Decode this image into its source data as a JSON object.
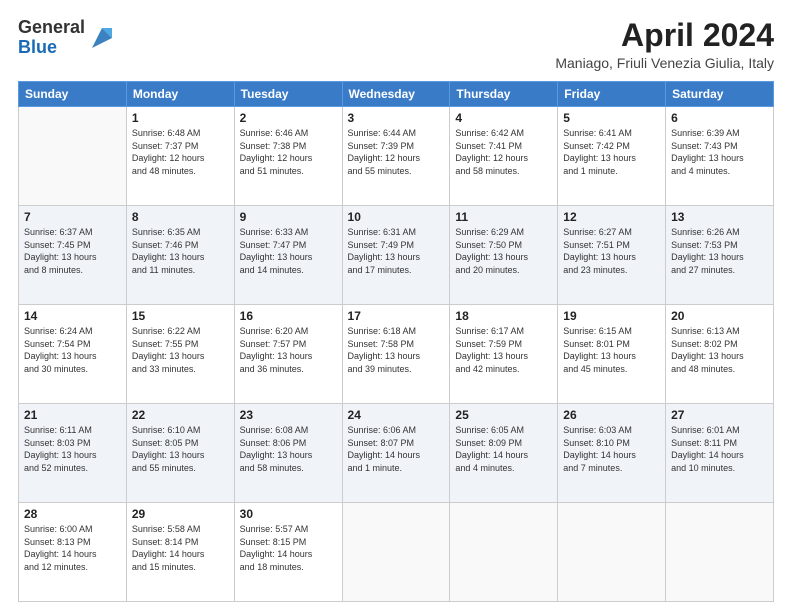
{
  "header": {
    "logo_general": "General",
    "logo_blue": "Blue",
    "month_title": "April 2024",
    "location": "Maniago, Friuli Venezia Giulia, Italy"
  },
  "days_of_week": [
    "Sunday",
    "Monday",
    "Tuesday",
    "Wednesday",
    "Thursday",
    "Friday",
    "Saturday"
  ],
  "weeks": [
    [
      {
        "day": "",
        "info": ""
      },
      {
        "day": "1",
        "info": "Sunrise: 6:48 AM\nSunset: 7:37 PM\nDaylight: 12 hours\nand 48 minutes."
      },
      {
        "day": "2",
        "info": "Sunrise: 6:46 AM\nSunset: 7:38 PM\nDaylight: 12 hours\nand 51 minutes."
      },
      {
        "day": "3",
        "info": "Sunrise: 6:44 AM\nSunset: 7:39 PM\nDaylight: 12 hours\nand 55 minutes."
      },
      {
        "day": "4",
        "info": "Sunrise: 6:42 AM\nSunset: 7:41 PM\nDaylight: 12 hours\nand 58 minutes."
      },
      {
        "day": "5",
        "info": "Sunrise: 6:41 AM\nSunset: 7:42 PM\nDaylight: 13 hours\nand 1 minute."
      },
      {
        "day": "6",
        "info": "Sunrise: 6:39 AM\nSunset: 7:43 PM\nDaylight: 13 hours\nand 4 minutes."
      }
    ],
    [
      {
        "day": "7",
        "info": "Sunrise: 6:37 AM\nSunset: 7:45 PM\nDaylight: 13 hours\nand 8 minutes."
      },
      {
        "day": "8",
        "info": "Sunrise: 6:35 AM\nSunset: 7:46 PM\nDaylight: 13 hours\nand 11 minutes."
      },
      {
        "day": "9",
        "info": "Sunrise: 6:33 AM\nSunset: 7:47 PM\nDaylight: 13 hours\nand 14 minutes."
      },
      {
        "day": "10",
        "info": "Sunrise: 6:31 AM\nSunset: 7:49 PM\nDaylight: 13 hours\nand 17 minutes."
      },
      {
        "day": "11",
        "info": "Sunrise: 6:29 AM\nSunset: 7:50 PM\nDaylight: 13 hours\nand 20 minutes."
      },
      {
        "day": "12",
        "info": "Sunrise: 6:27 AM\nSunset: 7:51 PM\nDaylight: 13 hours\nand 23 minutes."
      },
      {
        "day": "13",
        "info": "Sunrise: 6:26 AM\nSunset: 7:53 PM\nDaylight: 13 hours\nand 27 minutes."
      }
    ],
    [
      {
        "day": "14",
        "info": "Sunrise: 6:24 AM\nSunset: 7:54 PM\nDaylight: 13 hours\nand 30 minutes."
      },
      {
        "day": "15",
        "info": "Sunrise: 6:22 AM\nSunset: 7:55 PM\nDaylight: 13 hours\nand 33 minutes."
      },
      {
        "day": "16",
        "info": "Sunrise: 6:20 AM\nSunset: 7:57 PM\nDaylight: 13 hours\nand 36 minutes."
      },
      {
        "day": "17",
        "info": "Sunrise: 6:18 AM\nSunset: 7:58 PM\nDaylight: 13 hours\nand 39 minutes."
      },
      {
        "day": "18",
        "info": "Sunrise: 6:17 AM\nSunset: 7:59 PM\nDaylight: 13 hours\nand 42 minutes."
      },
      {
        "day": "19",
        "info": "Sunrise: 6:15 AM\nSunset: 8:01 PM\nDaylight: 13 hours\nand 45 minutes."
      },
      {
        "day": "20",
        "info": "Sunrise: 6:13 AM\nSunset: 8:02 PM\nDaylight: 13 hours\nand 48 minutes."
      }
    ],
    [
      {
        "day": "21",
        "info": "Sunrise: 6:11 AM\nSunset: 8:03 PM\nDaylight: 13 hours\nand 52 minutes."
      },
      {
        "day": "22",
        "info": "Sunrise: 6:10 AM\nSunset: 8:05 PM\nDaylight: 13 hours\nand 55 minutes."
      },
      {
        "day": "23",
        "info": "Sunrise: 6:08 AM\nSunset: 8:06 PM\nDaylight: 13 hours\nand 58 minutes."
      },
      {
        "day": "24",
        "info": "Sunrise: 6:06 AM\nSunset: 8:07 PM\nDaylight: 14 hours\nand 1 minute."
      },
      {
        "day": "25",
        "info": "Sunrise: 6:05 AM\nSunset: 8:09 PM\nDaylight: 14 hours\nand 4 minutes."
      },
      {
        "day": "26",
        "info": "Sunrise: 6:03 AM\nSunset: 8:10 PM\nDaylight: 14 hours\nand 7 minutes."
      },
      {
        "day": "27",
        "info": "Sunrise: 6:01 AM\nSunset: 8:11 PM\nDaylight: 14 hours\nand 10 minutes."
      }
    ],
    [
      {
        "day": "28",
        "info": "Sunrise: 6:00 AM\nSunset: 8:13 PM\nDaylight: 14 hours\nand 12 minutes."
      },
      {
        "day": "29",
        "info": "Sunrise: 5:58 AM\nSunset: 8:14 PM\nDaylight: 14 hours\nand 15 minutes."
      },
      {
        "day": "30",
        "info": "Sunrise: 5:57 AM\nSunset: 8:15 PM\nDaylight: 14 hours\nand 18 minutes."
      },
      {
        "day": "",
        "info": ""
      },
      {
        "day": "",
        "info": ""
      },
      {
        "day": "",
        "info": ""
      },
      {
        "day": "",
        "info": ""
      }
    ]
  ]
}
